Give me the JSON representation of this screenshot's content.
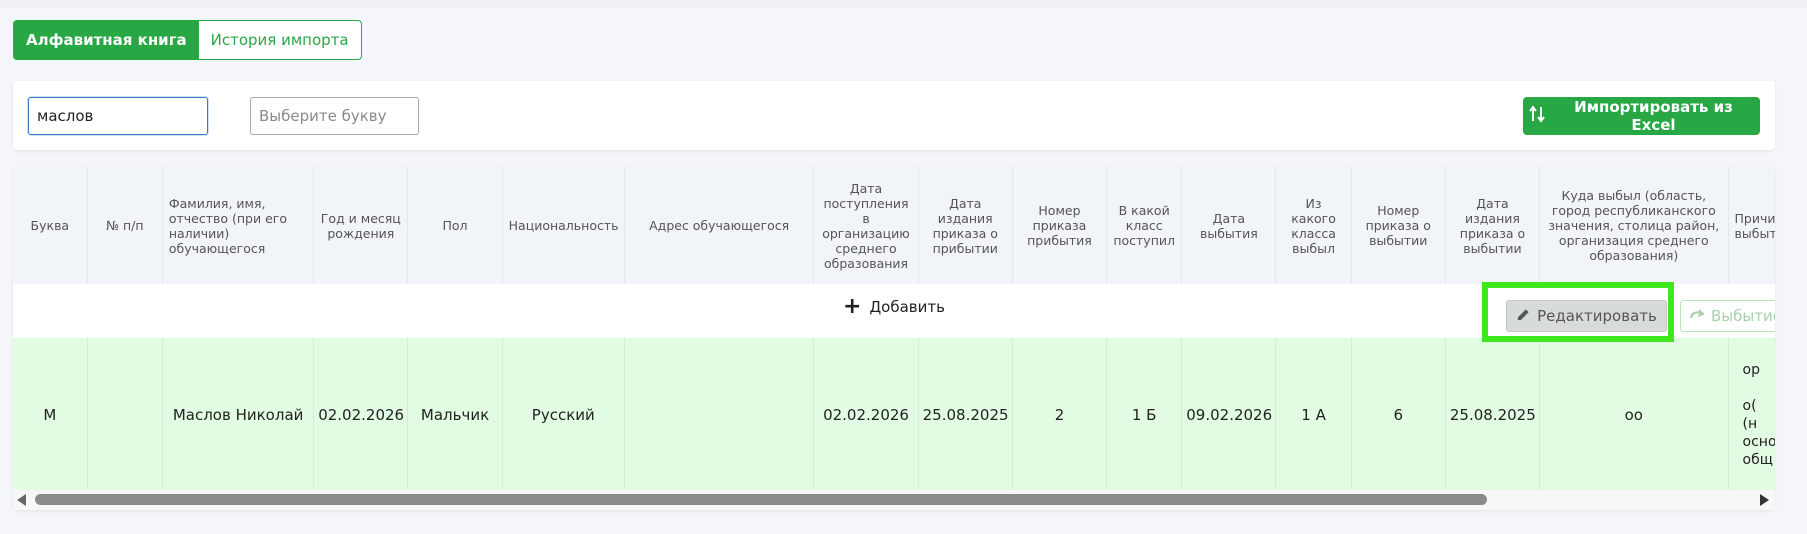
{
  "tabs": [
    {
      "label": "Алфавитная книга",
      "active": true
    },
    {
      "label": "История импорта",
      "active": false
    }
  ],
  "filters": {
    "search_value": "маслов",
    "letter_placeholder": "Выберите букву",
    "import_label": "Импортировать из Excel"
  },
  "table": {
    "columns": [
      "Буква",
      "№ п/п",
      "Фамилия, имя, отчество (при его наличии) обучающегося",
      "Год и месяц рождения",
      "Пол",
      "Национальность",
      "Адрес обучающегося",
      "Дата поступления в организацию среднего образования",
      "Дата издания приказа о прибытии",
      "Номер приказа прибытия",
      "В какой класс поступил",
      "Дата выбытия",
      "Из какого класса выбыл",
      "Номер приказа о выбытии",
      "Дата издания приказа о выбытии",
      "Куда выбыл (область, город республиканского значения, столица район, организация среднего образования)",
      "Причина выбытия"
    ],
    "add_label": "Добавить",
    "edit_label": "Редактировать",
    "exit_label": "Выбытие",
    "rows": [
      {
        "cells": [
          "М",
          "",
          "Маслов Николай",
          "02.02.2026",
          "Мальчик",
          "Русский",
          "",
          "02.02.2026",
          "25.08.2025",
          "2",
          "1 Б",
          "09.02.2026",
          "1 А",
          "6",
          "25.08.2025",
          "оо",
          "ор\n\nо(\n(н\nосновн\nобщ"
        ]
      }
    ]
  },
  "colors": {
    "accent": "#28a745",
    "row_bg": "#e2fbe3",
    "highlight": "#3ee81c"
  }
}
